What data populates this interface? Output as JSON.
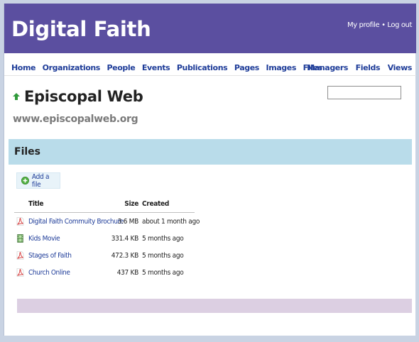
{
  "header": {
    "site_title": "Digital Faith",
    "my_profile": "My profile",
    "separator": " • ",
    "log_out": "Log out",
    "background": "#5b4fa0"
  },
  "nav": {
    "left": [
      "Home",
      "Organizations",
      "People",
      "Events",
      "Publications",
      "Pages",
      "Images",
      "Files"
    ],
    "right": [
      "Managers",
      "Fields",
      "Views"
    ]
  },
  "org": {
    "name": "Episcopal Web",
    "url": "www.episcopalweb.org"
  },
  "search": {
    "value": "",
    "placeholder": ""
  },
  "files_section": {
    "title": "Files",
    "add_label": "Add a file",
    "columns": {
      "title": "Title",
      "size": "Size",
      "created": "Created"
    },
    "rows": [
      {
        "icon": "pdf-icon",
        "title": "Digital Faith Commuity Brochure",
        "size": "3.6 MB",
        "created": "about 1 month ago"
      },
      {
        "icon": "movie-icon",
        "title": "Kids Movie",
        "size": "331.4 KB",
        "created": "5 months ago"
      },
      {
        "icon": "pdf-icon",
        "title": "Stages of Faith",
        "size": "472.3 KB",
        "created": "5 months ago"
      },
      {
        "icon": "pdf-icon",
        "title": "Church Online",
        "size": "437 KB",
        "created": "5 months ago"
      }
    ]
  },
  "colors": {
    "link": "#1f3d99",
    "section_bar": "#b9dcea",
    "footer_bar": "#dccfe2"
  }
}
